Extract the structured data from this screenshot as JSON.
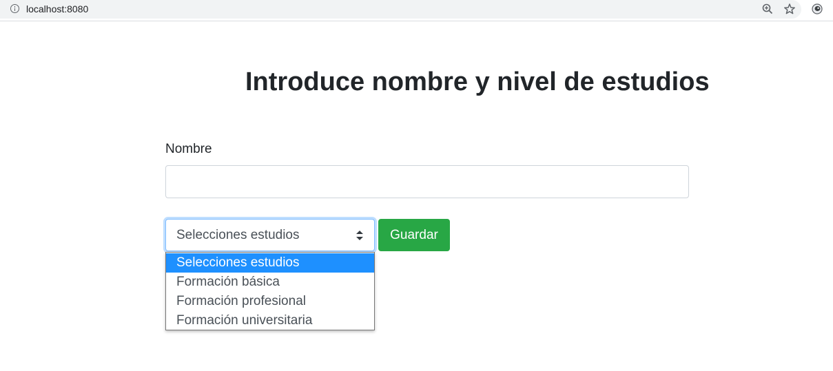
{
  "browser": {
    "url": "localhost:8080",
    "icons": [
      "info-icon",
      "zoom-icon",
      "star-icon",
      "extension-icon"
    ]
  },
  "page": {
    "title": "Introduce nombre y nivel de estudios"
  },
  "form": {
    "name_label": "Nombre",
    "name_value": "",
    "select": {
      "selected": "Selecciones estudios",
      "options": [
        "Selecciones estudios",
        "Formación básica",
        "Formación profesional",
        "Formación universitaria"
      ],
      "highlighted_index": 0,
      "open": true
    },
    "save_label": "Guardar"
  },
  "colors": {
    "save_button": "#28a745",
    "highlight": "#1e90ff",
    "focus_border": "#80bdff"
  }
}
